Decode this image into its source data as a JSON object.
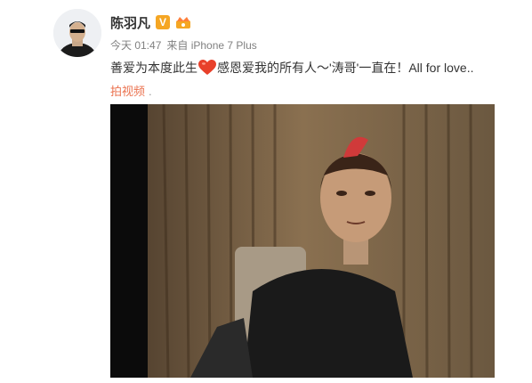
{
  "post": {
    "username": "陈羽凡",
    "verified_badge": "V",
    "time": "今天 01:47",
    "source": "来自 iPhone 7 Plus",
    "text_before": "善爱为本度此生",
    "text_after": "感恩爱我的所有人～'涛哥'一直在！All for love..",
    "video_link": "拍视频",
    "video_link_dot": "."
  },
  "colors": {
    "link": "#eb7350",
    "badge": "#f5a623",
    "heart": "#e8402a"
  },
  "icons": [
    "avatar",
    "verified-badge",
    "crown-badge-icon",
    "heart-emoji-icon",
    "play-video-frame"
  ]
}
